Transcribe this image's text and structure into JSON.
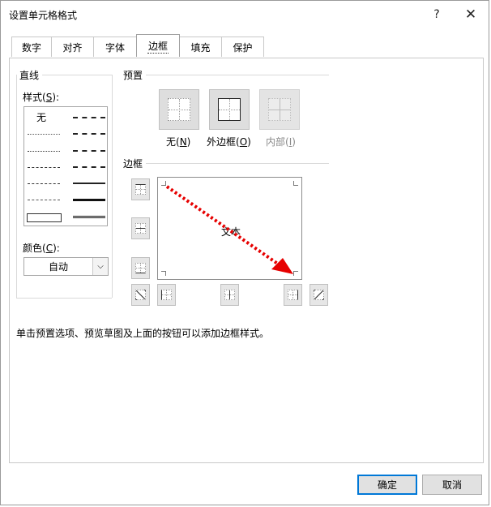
{
  "window": {
    "title": "设置单元格格式",
    "help": "?",
    "close": "✕"
  },
  "tabs": [
    {
      "label": "数字"
    },
    {
      "label": "对齐"
    },
    {
      "label": "字体"
    },
    {
      "label": "边框",
      "active": true
    },
    {
      "label": "填充"
    },
    {
      "label": "保护"
    }
  ],
  "line_group": {
    "title": "直线",
    "style_label": "样式(",
    "style_key": "S",
    "style_label_end": "):",
    "none_option": "无",
    "color_label": "颜色(",
    "color_key": "C",
    "color_label_end": "):",
    "color_value": "自动"
  },
  "presets": {
    "title": "预置",
    "none_label": "无(",
    "none_key": "N",
    "outline_label": "外边框(",
    "outline_key": "O",
    "inside_label": "内部(",
    "inside_key": "I",
    "close_paren": ")"
  },
  "border": {
    "title": "边框",
    "preview_text": "文本"
  },
  "hint": "单击预置选项、预览草图及上面的按钮可以添加边框样式。",
  "buttons": {
    "ok": "确定",
    "cancel": "取消"
  },
  "colors": {
    "accent": "#0078d7",
    "arrow": "#e60000"
  }
}
